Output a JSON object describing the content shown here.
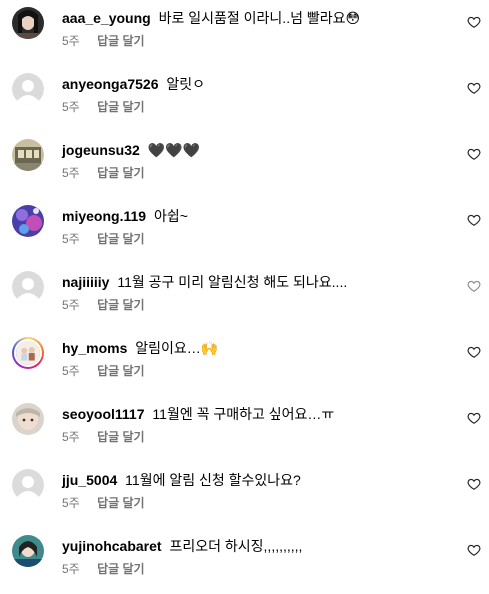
{
  "reply_label": "답글 달기",
  "comments": [
    {
      "username": "aaa_e_young",
      "text": "바로 일시품절 이라니..넘 빨라요😳",
      "time": "5주"
    },
    {
      "username": "anyeonga7526",
      "text": "알릿ㅇ",
      "time": "5주"
    },
    {
      "username": "jogeunsu32",
      "text": "🖤🖤🖤",
      "time": "5주"
    },
    {
      "username": "miyeong.119",
      "text": "아쉽~",
      "time": "5주"
    },
    {
      "username": "najiiiiiy",
      "text": "11월 공구 미리 알림신청 해도 되나요....",
      "time": "5주"
    },
    {
      "username": "hy_moms",
      "text": "알림이요…🙌",
      "time": "5주"
    },
    {
      "username": "seoyool1117",
      "text": "11월엔 꼭 구매하고 싶어요…ㅠ",
      "time": "5주"
    },
    {
      "username": "jju_5004",
      "text": "11월에 알림 신청 할수있나요?",
      "time": "5주"
    },
    {
      "username": "yujinohcabaret",
      "text": "프리오더 하시징,,,,,,,,,,",
      "time": "5주"
    }
  ]
}
